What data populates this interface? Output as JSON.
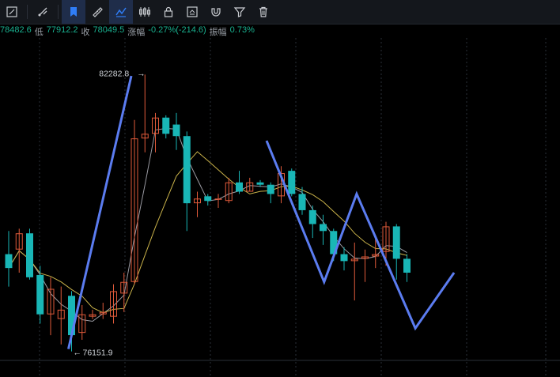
{
  "toolbar": {
    "tools": [
      {
        "id": "ruler-pencil",
        "active": false
      },
      {
        "id": "brush",
        "active": false
      },
      {
        "id": "bookmark",
        "active": true
      },
      {
        "id": "ruler",
        "active": false
      },
      {
        "id": "draw-line",
        "active": true
      },
      {
        "id": "candles",
        "active": false
      },
      {
        "id": "lock",
        "active": false
      },
      {
        "id": "edit-box",
        "active": false
      },
      {
        "id": "magnet",
        "active": false
      },
      {
        "id": "filter",
        "active": false
      },
      {
        "id": "trash",
        "active": false
      }
    ]
  },
  "quote": {
    "open_value": "78482.6",
    "low_label": "低",
    "low_value": "77912.2",
    "close_label": "收",
    "close_value": "78049.5",
    "change_label": "涨幅",
    "change_value": "-0.27%(-214.6)",
    "amplitude_label": "振幅",
    "amplitude_value": "0.73%"
  },
  "annotations": {
    "high": "82282.8",
    "low": "76151.9"
  },
  "colors": {
    "up": "#e05a3a",
    "down": "#19b6b6",
    "drawing": "#5b7cf0",
    "ma_fast": "#9a9aa2",
    "ma_slow": "#c9b24a",
    "info_green": "#19b08f"
  },
  "chart_data": {
    "type": "candlestick",
    "candles": [
      {
        "o": 78400,
        "h": 78900,
        "l": 77700,
        "c": 78100
      },
      {
        "o": 78500,
        "h": 78950,
        "l": 78000,
        "c": 78850
      },
      {
        "o": 78850,
        "h": 78950,
        "l": 77850,
        "c": 77900
      },
      {
        "o": 77950,
        "h": 78150,
        "l": 76900,
        "c": 77100
      },
      {
        "o": 77100,
        "h": 77900,
        "l": 76650,
        "c": 77650
      },
      {
        "o": 77000,
        "h": 77700,
        "l": 76450,
        "c": 77200
      },
      {
        "o": 77500,
        "h": 77600,
        "l": 76300,
        "c": 76650
      },
      {
        "o": 76700,
        "h": 77300,
        "l": 76550,
        "c": 77100
      },
      {
        "o": 77050,
        "h": 77200,
        "l": 77000,
        "c": 77100
      },
      {
        "o": 77100,
        "h": 77350,
        "l": 77000,
        "c": 77150
      },
      {
        "o": 77050,
        "h": 77750,
        "l": 76900,
        "c": 77600
      },
      {
        "o": 77550,
        "h": 78000,
        "l": 77150,
        "c": 77800
      },
      {
        "o": 77800,
        "h": 81300,
        "l": 77750,
        "c": 80900
      },
      {
        "o": 80900,
        "h": 82280,
        "l": 80600,
        "c": 81000
      },
      {
        "o": 81000,
        "h": 81450,
        "l": 80600,
        "c": 81350
      },
      {
        "o": 81350,
        "h": 81400,
        "l": 80900,
        "c": 81000
      },
      {
        "o": 81200,
        "h": 81450,
        "l": 80650,
        "c": 80950
      },
      {
        "o": 80950,
        "h": 81050,
        "l": 78900,
        "c": 79500
      },
      {
        "o": 79500,
        "h": 79750,
        "l": 79200,
        "c": 79600
      },
      {
        "o": 79650,
        "h": 79700,
        "l": 79450,
        "c": 79550
      },
      {
        "o": 79600,
        "h": 79700,
        "l": 79400,
        "c": 79600
      },
      {
        "o": 79550,
        "h": 80050,
        "l": 79500,
        "c": 79950
      },
      {
        "o": 79950,
        "h": 80200,
        "l": 79700,
        "c": 79750
      },
      {
        "o": 79750,
        "h": 80050,
        "l": 79750,
        "c": 79950
      },
      {
        "o": 79950,
        "h": 80000,
        "l": 79850,
        "c": 79900
      },
      {
        "o": 79900,
        "h": 79950,
        "l": 79500,
        "c": 79700
      },
      {
        "o": 79650,
        "h": 80300,
        "l": 79500,
        "c": 80150
      },
      {
        "o": 80200,
        "h": 80250,
        "l": 79650,
        "c": 79700
      },
      {
        "o": 79700,
        "h": 79850,
        "l": 79250,
        "c": 79350
      },
      {
        "o": 79350,
        "h": 79450,
        "l": 78750,
        "c": 79050
      },
      {
        "o": 79050,
        "h": 79250,
        "l": 78600,
        "c": 78900
      },
      {
        "o": 78900,
        "h": 78950,
        "l": 78250,
        "c": 78400
      },
      {
        "o": 78400,
        "h": 78550,
        "l": 78050,
        "c": 78250
      },
      {
        "o": 78250,
        "h": 78650,
        "l": 77400,
        "c": 78300
      },
      {
        "o": 78300,
        "h": 78500,
        "l": 77800,
        "c": 78350
      },
      {
        "o": 78350,
        "h": 78750,
        "l": 78100,
        "c": 78400
      },
      {
        "o": 78450,
        "h": 79100,
        "l": 78150,
        "c": 79000
      },
      {
        "o": 79000,
        "h": 79050,
        "l": 77850,
        "c": 78300
      },
      {
        "o": 78300,
        "h": 78400,
        "l": 77800,
        "c": 78000
      }
    ],
    "drawing_polyline": [
      {
        "i": 5.7,
        "v": 76350
      },
      {
        "i": 11.7,
        "v": 82250
      },
      null,
      {
        "i": 24.6,
        "v": 80850
      },
      {
        "i": 30.1,
        "v": 77800
      },
      {
        "i": 33.2,
        "v": 79700
      },
      {
        "i": 38.8,
        "v": 76800
      },
      {
        "i": 42.5,
        "v": 78000
      }
    ],
    "ylim": [
      75900,
      82900
    ]
  }
}
